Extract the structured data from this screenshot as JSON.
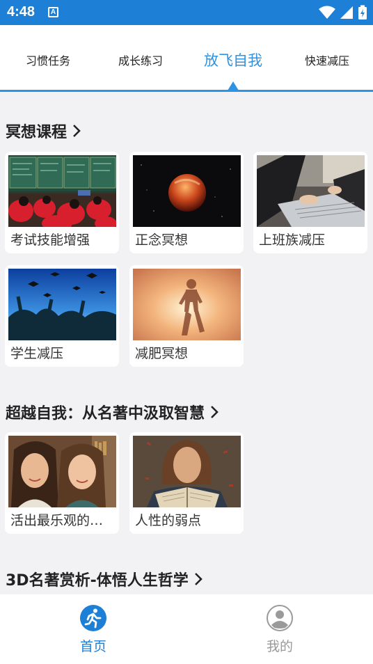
{
  "status_bar": {
    "time": "4:48",
    "notification_glyph": "A"
  },
  "tabs": [
    {
      "label": "习惯任务",
      "active": false
    },
    {
      "label": "成长练习",
      "active": false
    },
    {
      "label": "放飞自我",
      "active": true
    },
    {
      "label": "快速减压",
      "active": false
    }
  ],
  "sections": [
    {
      "title": "冥想课程",
      "cards": [
        {
          "label": "考试技能增强",
          "image": "classroom-students"
        },
        {
          "label": "正念冥想",
          "image": "blood-moon"
        },
        {
          "label": "上班族减压",
          "image": "office-laptop"
        },
        {
          "label": "学生减压",
          "image": "graduation-caps"
        },
        {
          "label": "减肥冥想",
          "image": "sunset-runner"
        }
      ]
    },
    {
      "title": "超越自我：从名著中汲取智慧",
      "cards": [
        {
          "label": "活出最乐观的…",
          "image": "two-smiling-women"
        },
        {
          "label": "人性的弱点",
          "image": "man-reading-book"
        }
      ]
    },
    {
      "title": "3D名著赏析-体悟人生哲学",
      "cards": []
    }
  ],
  "bottom_nav": [
    {
      "label": "首页",
      "icon": "running-person-icon",
      "active": true
    },
    {
      "label": "我的",
      "icon": "user-profile-icon",
      "active": false
    }
  ],
  "colors": {
    "status_bar": "#1e7fd6",
    "accent": "#2e93e3",
    "page_background": "#f2f2f4"
  }
}
